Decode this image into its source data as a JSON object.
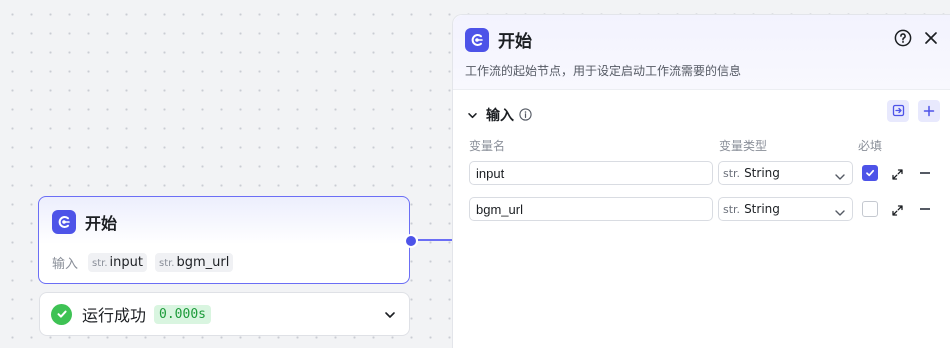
{
  "node": {
    "title": "开始",
    "inputs_label": "输入",
    "inputs": [
      {
        "type": "str.",
        "name": "input"
      },
      {
        "type": "str.",
        "name": "bgm_url"
      }
    ]
  },
  "status": {
    "text": "运行成功",
    "time": "0.000s"
  },
  "panel": {
    "title": "开始",
    "description": "工作流的起始节点，用于设定启动工作流需要的信息",
    "section_title": "输入",
    "columns": {
      "name": "变量名",
      "type": "变量类型",
      "required": "必填"
    },
    "rows": [
      {
        "name": "input",
        "type_prefix": "str.",
        "type": "String",
        "required": true
      },
      {
        "name": "bgm_url",
        "type_prefix": "str.",
        "type": "String",
        "required": false
      }
    ]
  },
  "colors": {
    "accent": "#4d53e8",
    "success": "#3ec254"
  },
  "icons": {
    "logo": "start-node-icon",
    "help": "question-circle-icon",
    "close": "close-icon",
    "collapse": "chevron-down-icon",
    "info": "info-icon",
    "import": "import-icon",
    "add": "plus-icon",
    "expand": "expand-icon",
    "remove": "minus-icon"
  }
}
